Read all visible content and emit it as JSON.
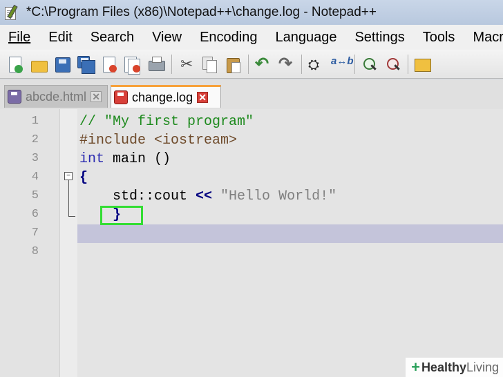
{
  "window": {
    "title": "*C:\\Program Files (x86)\\Notepad++\\change.log - Notepad++"
  },
  "menu": [
    {
      "label": "File"
    },
    {
      "label": "Edit"
    },
    {
      "label": "Search"
    },
    {
      "label": "View"
    },
    {
      "label": "Encoding"
    },
    {
      "label": "Language"
    },
    {
      "label": "Settings"
    },
    {
      "label": "Tools"
    },
    {
      "label": "Macro"
    }
  ],
  "toolbar": {
    "icons": [
      "new-file-icon",
      "open-file-icon",
      "save-icon",
      "save-all-icon",
      "close-icon",
      "close-all-icon",
      "print-icon",
      "cut-icon",
      "copy-icon",
      "paste-icon",
      "undo-icon",
      "redo-icon",
      "find-icon",
      "replace-icon",
      "zoom-in-icon",
      "zoom-out-icon",
      "sync-scroll-icon"
    ]
  },
  "tabs": [
    {
      "label": "abcde.html",
      "active": false,
      "close": "✕"
    },
    {
      "label": "change.log",
      "active": true,
      "close": "✕"
    }
  ],
  "editor": {
    "line_numbers": [
      "1",
      "2",
      "3",
      "4",
      "5",
      "6",
      "7",
      "8"
    ],
    "current_line": 7,
    "lines": {
      "l1": "// \"My first program\"",
      "l2_directive": "#include <iostream>",
      "l3_keyword": "int",
      "l3_rest": " main ()",
      "l4": "{",
      "l5_a": "    std::cout ",
      "l5_op": "<<",
      "l5_str": " \"Hello World!\"",
      "l6": "    }"
    },
    "fold_marker": "−"
  },
  "watermark": {
    "mark": "+",
    "bold": "Healthy",
    "normal": "Living"
  },
  "colors": {
    "comment": "#1e8a1e",
    "keyword": "#2a2ab0",
    "string": "#808080",
    "current_line": "#c4c4da",
    "highlight": "#33dd33",
    "active_tab_accent": "#f7a13a"
  }
}
